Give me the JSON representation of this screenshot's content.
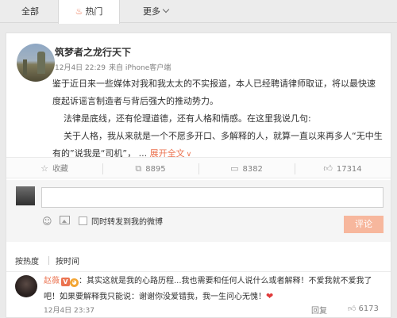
{
  "tabs": {
    "all": "全部",
    "hot": "热门",
    "more": "更多"
  },
  "post": {
    "author": "筑梦者之龙行天下",
    "time": "12月4日 22:29",
    "source": "来自 iPhone客户端",
    "paragraph1": "鉴于近日来一些媒体对我和我太太的不实报道，本人已经聘请律师取证，将以最快速度起诉谣言制造者与背后强大的推动势力。",
    "paragraph2": "法律是底线，还有伦理道德，还有人格和情感。在这里我说几句:",
    "paragraph3": "关于人格，我从来就是一个不愿多开口、多解释的人，就算一直以来再多人“无中生有的”说我是“司机”，  ...",
    "expand": "展开全文",
    "expand_arrow": "∨"
  },
  "actions": {
    "favorite": "收藏",
    "repost": "8895",
    "comment": "8382",
    "like": "17314"
  },
  "comment_box": {
    "placeholder": "",
    "forward_label": "同时转发到我的微博",
    "submit": "评论"
  },
  "sort": {
    "by_hot": "按热度",
    "by_time": "按时间"
  },
  "comment": {
    "name": "赵薇",
    "vbadge": "V",
    "vip": "◕",
    "text": "：其实这就是我的心路历程...我也需要和任何人说什么或者解释！不爱我就不爱我了吧！如果要解释我只能说：谢谢你没爱错我，我一生问心无愧！",
    "time": "12月4日 23:37",
    "reply": "回复",
    "likes": "6173"
  },
  "colors": {
    "accent": "#eb7350",
    "submit_bg": "#f7b79d"
  },
  "icons": {
    "hot_tab": "flame-icon",
    "more_tab": "chevron-down-icon",
    "favorite": "star-icon",
    "repost": "repost-icon",
    "comment": "comment-icon",
    "like": "thumbs-up-icon",
    "emoji": "emoji-icon",
    "image": "image-icon"
  }
}
